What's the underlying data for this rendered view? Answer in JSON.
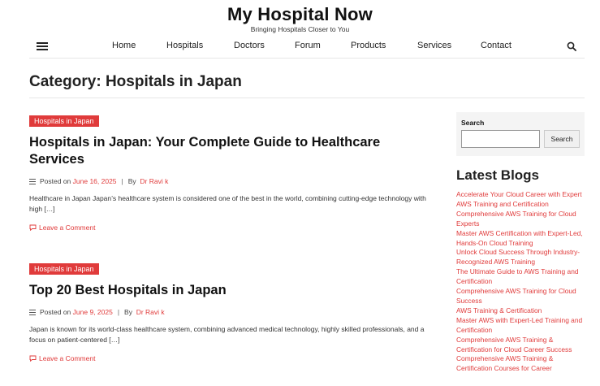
{
  "site": {
    "title": "My Hospital Now",
    "tagline": "Bringing Hospitals Closer to You"
  },
  "nav": {
    "items": [
      "Home",
      "Hospitals",
      "Doctors",
      "Forum",
      "Products",
      "Services",
      "Contact"
    ]
  },
  "page": {
    "title": "Category: Hospitals in Japan"
  },
  "posts": [
    {
      "category": "Hospitals in Japan",
      "title": "Hospitals in Japan: Your Complete Guide to Healthcare Services",
      "posted_on": "Posted on",
      "date": "June 16, 2025",
      "by": "By",
      "author": "Dr Ravi k",
      "excerpt": "Healthcare in Japan Japan’s healthcare system is considered one of the best in the world, combining cutting-edge technology with high […]",
      "comment": "Leave a Comment"
    },
    {
      "category": "Hospitals in Japan",
      "title": "Top 20 Best Hospitals in Japan",
      "posted_on": "Posted on",
      "date": "June 9, 2025",
      "by": "By",
      "author": "Dr Ravi k",
      "excerpt": "Japan is known for its world-class healthcare system, combining advanced medical technology, highly skilled professionals, and a focus on patient-centered […]",
      "comment": "Leave a Comment"
    }
  ],
  "sidebar": {
    "search_label": "Search",
    "search_placeholder": "",
    "search_button": "Search",
    "latest_heading": "Latest Blogs",
    "blogs": [
      "Accelerate Your Cloud Career with Expert AWS Training and Certification",
      "Comprehensive AWS Training for Cloud Experts",
      "Master AWS Certification with Expert-Led, Hands-On Cloud Training",
      "Unlock Cloud Success Through Industry-Recognized AWS Training",
      "The Ultimate Guide to AWS Training and Certification",
      "Comprehensive AWS Training for Cloud Success",
      "AWS Training & Certification",
      "Master AWS with Expert-Led Training and Certification",
      "Comprehensive AWS Training & Certification for Cloud Career Success",
      "Comprehensive AWS Training & Certification Courses for Career"
    ]
  },
  "colors": {
    "accent": "#e03b3b",
    "text": "#222222",
    "sidebar_bg": "#f4f4f4"
  },
  "icons": {
    "menu": "hamburger-icon",
    "search": "search-icon",
    "meta": "lines-icon",
    "comment": "speech-bubble-icon"
  }
}
